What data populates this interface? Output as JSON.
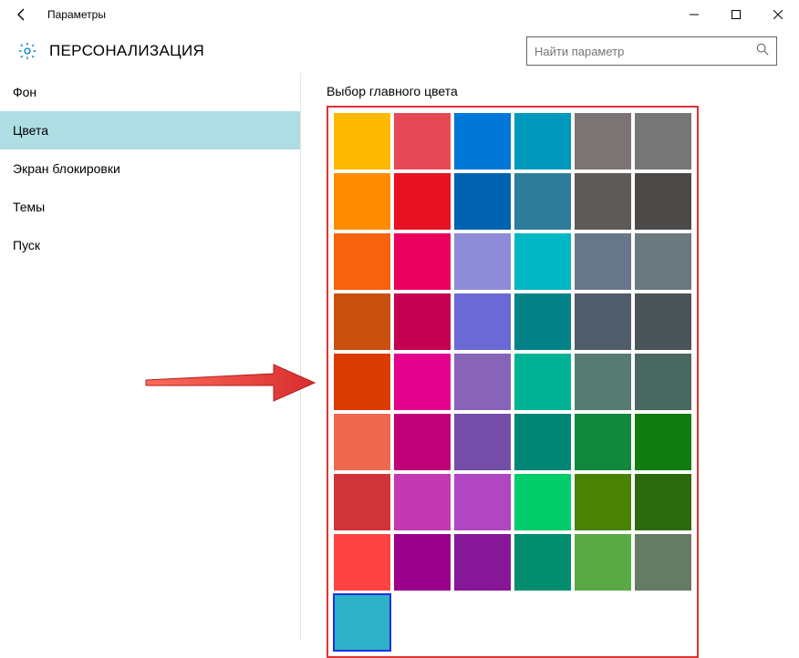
{
  "window": {
    "title": "Параметры"
  },
  "header": {
    "heading": "ПЕРСОНАЛИЗАЦИЯ"
  },
  "search": {
    "placeholder": "Найти параметр"
  },
  "sidebar": {
    "items": [
      {
        "label": "Фон",
        "selected": false
      },
      {
        "label": "Цвета",
        "selected": true
      },
      {
        "label": "Экран блокировки",
        "selected": false
      },
      {
        "label": "Темы",
        "selected": false
      },
      {
        "label": "Пуск",
        "selected": false
      }
    ]
  },
  "main": {
    "section_title": "Выбор главного цвета",
    "colors": [
      "#ffb900",
      "#e74856",
      "#0078d7",
      "#0099bc",
      "#7a7574",
      "#767676",
      "#ff8c00",
      "#e81123",
      "#0063b1",
      "#2d7d9a",
      "#5d5a58",
      "#4c4a48",
      "#f7630c",
      "#ea005e",
      "#8e8cd8",
      "#00b7c3",
      "#68768a",
      "#69797e",
      "#ca5010",
      "#c30052",
      "#6b69d6",
      "#038387",
      "#515c6b",
      "#4a5459",
      "#da3b01",
      "#e3008c",
      "#8764b8",
      "#00b294",
      "#567c73",
      "#486860",
      "#ef6950",
      "#bf0077",
      "#744da9",
      "#018574",
      "#10893e",
      "#107c10",
      "#d13438",
      "#c239b3",
      "#b146c2",
      "#00cc6a",
      "#498205",
      "#2d6a0e",
      "#ff4343",
      "#9a0089",
      "#881798",
      "#038d6f",
      "#5aa944",
      "#647c64",
      "#2fb1c7"
    ],
    "selected_index": 48
  },
  "icons": {
    "back": "back-icon",
    "minimize": "minimize-icon",
    "maximize": "maximize-icon",
    "close": "close-icon",
    "gear": "gear-icon",
    "search": "search-icon"
  }
}
